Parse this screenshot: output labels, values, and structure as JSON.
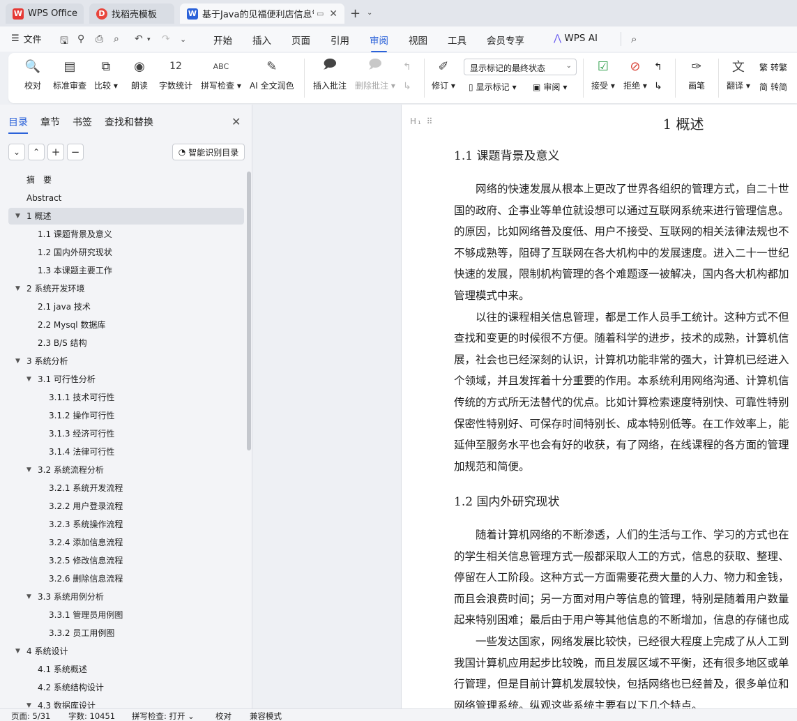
{
  "tabs": [
    {
      "label": "WPS Office",
      "icon": "W"
    },
    {
      "label": "找稻壳模板",
      "icon": "D"
    },
    {
      "label": "基于Java的见福便利店信息管",
      "icon": "W"
    }
  ],
  "menu": {
    "file": "文件",
    "items": [
      "开始",
      "插入",
      "页面",
      "引用",
      "审阅",
      "视图",
      "工具",
      "会员专享",
      "WPS AI"
    ],
    "active": "审阅"
  },
  "ribbon": {
    "proofread": "校对",
    "standard_review": "标准审查",
    "compare": "比较",
    "read_aloud": "朗读",
    "word_count": "字数统计",
    "spell_check": "拼写检查",
    "ai_polish": "AI 全文润色",
    "insert_comment": "插入批注",
    "delete_comment": "删除批注",
    "revise": "修订",
    "markup_mode": "显示标记的最终状态",
    "show_markup": "显示标记",
    "review": "审阅",
    "accept": "接受",
    "reject": "拒绝",
    "pen": "画笔",
    "translate": "翻译",
    "to_traditional": "转繁",
    "to_simplified": "转简"
  },
  "sidebar": {
    "tabs": [
      "目录",
      "章节",
      "书签",
      "查找和替换"
    ],
    "smart_toc": "智能识别目录",
    "toc": [
      {
        "label": "摘　要",
        "level": 0,
        "toggle": ""
      },
      {
        "label": "Abstract",
        "level": 0,
        "toggle": ""
      },
      {
        "label": "1  概述",
        "level": 0,
        "toggle": "▼",
        "selected": true
      },
      {
        "label": "1.1 课题背景及意义",
        "level": 1,
        "toggle": ""
      },
      {
        "label": "1.2  国内外研究现状",
        "level": 1,
        "toggle": ""
      },
      {
        "label": "1.3  本课题主要工作",
        "level": 1,
        "toggle": ""
      },
      {
        "label": "2  系统开发环境",
        "level": 0,
        "toggle": "▼"
      },
      {
        "label": "2.1 java 技术",
        "level": 1,
        "toggle": ""
      },
      {
        "label": "2.2 Mysql 数据库",
        "level": 1,
        "toggle": ""
      },
      {
        "label": "2.3 B/S 结构",
        "level": 1,
        "toggle": ""
      },
      {
        "label": "3  系统分析",
        "level": 0,
        "toggle": "▼"
      },
      {
        "label": "3.1  可行性分析",
        "level": 1,
        "toggle": "▼"
      },
      {
        "label": "3.1.1  技术可行性",
        "level": 2,
        "toggle": ""
      },
      {
        "label": "3.1.2 操作可行性",
        "level": 2,
        "toggle": ""
      },
      {
        "label": "3.1.3  经济可行性",
        "level": 2,
        "toggle": ""
      },
      {
        "label": "3.1.4  法律可行性",
        "level": 2,
        "toggle": ""
      },
      {
        "label": "3.2 系统流程分析",
        "level": 1,
        "toggle": "▼"
      },
      {
        "label": "3.2.1 系统开发流程",
        "level": 2,
        "toggle": ""
      },
      {
        "label": "3.2.2  用户登录流程",
        "level": 2,
        "toggle": ""
      },
      {
        "label": "3.2.3  系统操作流程",
        "level": 2,
        "toggle": ""
      },
      {
        "label": "3.2.4  添加信息流程",
        "level": 2,
        "toggle": ""
      },
      {
        "label": "3.2.5  修改信息流程",
        "level": 2,
        "toggle": ""
      },
      {
        "label": "3.2.6  删除信息流程",
        "level": 2,
        "toggle": ""
      },
      {
        "label": "3.3 系统用例分析",
        "level": 1,
        "toggle": "▼"
      },
      {
        "label": "3.3.1 管理员用例图",
        "level": 2,
        "toggle": ""
      },
      {
        "label": "3.3.2 员工用例图",
        "level": 2,
        "toggle": ""
      },
      {
        "label": "4  系统设计",
        "level": 0,
        "toggle": "▼"
      },
      {
        "label": "4.1  系统概述",
        "level": 1,
        "toggle": ""
      },
      {
        "label": "4.2  系统结构设计",
        "level": 1,
        "toggle": ""
      },
      {
        "label": "4.3 数据库设计",
        "level": 1,
        "toggle": "▼"
      }
    ]
  },
  "doc": {
    "chapter": "1  概述",
    "s1": "1.1 课题背景及意义",
    "p1": [
      "　　网络的快速发展从根本上更改了世界各组织的管理方式，自二十世",
      "国的政府、企事业等单位就设想可以通过互联网系统来进行管理信息。",
      "的原因，比如网络普及度低、用户不接受、互联网的相关法律法规也不",
      "不够成熟等，阻碍了互联网在各大机构中的发展速度。进入二十一世纪",
      "快速的发展，限制机构管理的各个难题逐一被解决，国内各大机构都加",
      "管理模式中来。",
      "　　以往的课程相关信息管理，都是工作人员手工统计。这种方式不但",
      "查找和变更的时候很不方便。随着科学的进步，技术的成熟，计算机信",
      "展，社会也已经深刻的认识，计算机功能非常的强大，计算机已经进入",
      "个领域，并且发挥着十分重要的作用。本系统利用网络沟通、计算机信",
      "传统的方式所无法替代的优点。比如计算检索速度特别快、可靠性特别",
      "保密性特别好、可保存时间特别长、成本特别低等。在工作效率上，能",
      "延伸至服务水平也会有好的收获，有了网络，在线课程的各方面的管理",
      "加规范和简便。"
    ],
    "s2": "1.2  国内外研究现状",
    "p2": [
      "　　随着计算机网络的不断渗透，人们的生活与工作、学习的方式也在",
      "的学生相关信息管理方式一般都采取人工的方式，信息的获取、整理、",
      "停留在人工阶段。这种方式一方面需要花费大量的人力、物力和金钱，",
      "而且会浪费时间；另一方面对用户等信息的管理，特别是随着用户数量",
      "起来特别困难；最后由于用户等其他信息的不断增加，信息的存储也成",
      "　　一些发达国家，网络发展比较快，已经很大程度上完成了从人工到",
      "我国计算机应用起步比较晚，而且发展区域不平衡，还有很多地区或单",
      "行管理，但是目前计算机发展较快，包括网络也已经普及，很多单位和",
      "网络管理系统。纵观这些系统主要有以下几个特点。"
    ]
  },
  "status": {
    "page": "页面: 5/31",
    "words": "字数: 10451",
    "spell": "拼写检查: 打开",
    "proof": "校对",
    "compat": "兼容模式"
  }
}
